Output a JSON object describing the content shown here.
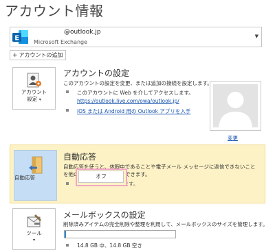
{
  "header": {
    "title": "アカウント情報"
  },
  "account": {
    "email": "@outlook.jp",
    "type": "Microsoft Exchange",
    "add_label": "アカウントの追加"
  },
  "account_settings": {
    "tile_label_line1": "アカウント",
    "tile_label_line2": "設定",
    "title": "アカウントの設定",
    "description": "このアカウントの設定を変更、または追加の接続を設定します。",
    "bullet_web": "このアカウントに Web を介してアクセスします。",
    "owa_link": "https://outlook.live.com/owa/outlook.jp/",
    "mobile_link": "iOS または Android 用の Outlook アプリを入手",
    "change_link": "変更"
  },
  "auto_reply": {
    "tile_label": "自動応答",
    "title": "自動応答",
    "description": "自動応答を使うと、休暇中であることや電子メール メッセージに返信できないことを他の人に知らせることができます。",
    "status": "自動応答が送信されます。",
    "off_label": "オフ"
  },
  "mailbox": {
    "tile_label": "ツール",
    "title": "メールボックスの設定",
    "description": "削除済みアイテムの完全削除や整理を利用して、メールボックスのサイズを管理します。",
    "usage": "14.8 GB 中、14.8 GB 空き",
    "used_fraction": 0.01
  },
  "colors": {
    "highlight_bg": "#fdf2c5",
    "tile_selected": "#c5def5",
    "link": "#1a56b0",
    "progress": "#2d8bd6",
    "annotation": "#f3a6c6"
  }
}
